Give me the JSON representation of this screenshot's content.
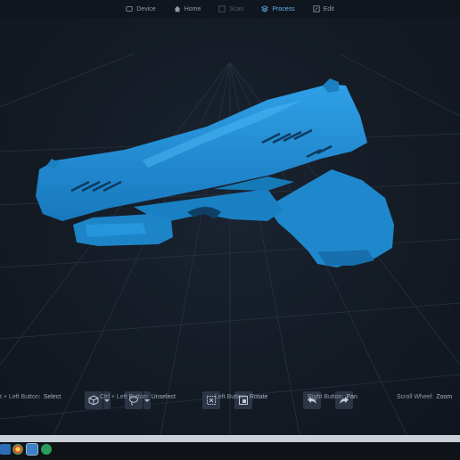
{
  "nav": {
    "tabs": [
      {
        "label": "Device",
        "icon": "device-icon",
        "state": "normal"
      },
      {
        "label": "Home",
        "icon": "home-icon",
        "state": "normal"
      },
      {
        "label": "Scan",
        "icon": "scan-icon",
        "state": "disabled"
      },
      {
        "label": "Process",
        "icon": "layers-icon",
        "state": "active"
      },
      {
        "label": "Edit",
        "icon": "edit-icon",
        "state": "normal"
      }
    ]
  },
  "toolbar": {
    "buttons": [
      {
        "name": "select-mode",
        "icon": "cube-select-icon",
        "has_dropdown": true
      },
      {
        "name": "lasso-mode",
        "icon": "lasso-icon",
        "has_dropdown": true
      },
      {
        "name": "invert-selection",
        "icon": "invert-selection-icon",
        "has_dropdown": false
      },
      {
        "name": "delete-selection",
        "icon": "delete-selection-icon",
        "has_dropdown": false
      },
      {
        "name": "undo",
        "icon": "undo-icon",
        "has_dropdown": false
      },
      {
        "name": "redo",
        "icon": "redo-icon",
        "has_dropdown": false
      }
    ]
  },
  "hints": [
    {
      "key": "t + Left Button:",
      "value": "Select"
    },
    {
      "key": "Ctrl + Left Button:",
      "value": "Unselect"
    },
    {
      "key": "Left Button:",
      "value": "Rotate"
    },
    {
      "key": "Right Button:",
      "value": "Pan"
    },
    {
      "key": "Scroll Wheel:",
      "value": "Zoom"
    }
  ],
  "colors": {
    "accent": "#5fb3ef",
    "model": "#1f8ad0",
    "background": "#141b25"
  }
}
